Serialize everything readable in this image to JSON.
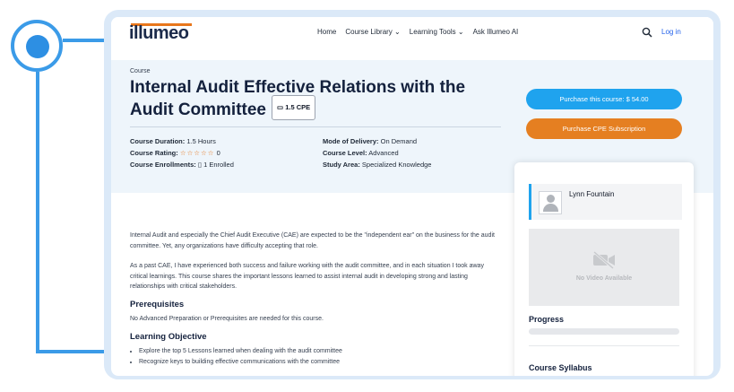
{
  "header": {
    "logo": "illumeo",
    "nav": [
      "Home",
      "Course Library",
      "Learning Tools",
      "Ask Illumeo AI"
    ],
    "login": "Log in"
  },
  "hero": {
    "breadcrumb": "Course",
    "title": "Internal Audit Effective Relations with the Audit Committee",
    "cpe_badge": "1.5 CPE",
    "meta_left": [
      {
        "label": "Course Duration:",
        "value": "1.5 Hours"
      },
      {
        "label": "Course Rating:",
        "value": "0"
      },
      {
        "label": "Course Enrollments:",
        "value": "1 Enrolled"
      }
    ],
    "meta_right": [
      {
        "label": "Mode of Delivery:",
        "value": "On Demand"
      },
      {
        "label": "Course Level:",
        "value": "Advanced"
      },
      {
        "label": "Study Area:",
        "value": "Specialized Knowledge"
      }
    ],
    "rating_stars": 0
  },
  "buttons": {
    "purchase": "Purchase this course: $ 54.00",
    "subscription": "Purchase CPE Subscription"
  },
  "card": {
    "instructor": "Lynn Fountain",
    "video_placeholder": "No Video Available",
    "progress_label": "Progress",
    "progress": 0,
    "syllabus_label": "Course Syllabus"
  },
  "content": {
    "p1": "Internal Audit and especially the Chief Audit Executive (CAE) are expected to be the \"independent ear\" on the business for the audit committee.  Yet, any organizations have difficulty accepting that role.",
    "p2": "As a past CAE, I have experienced both success and failure working with the audit committee, and in each situation I took away critical learnings.  This course shares the important lessons learned to assist internal audit in developing strong and lasting relationships with critical stakeholders.",
    "prereq_heading": "Prerequisites",
    "prereq_text": "No Advanced Preparation or Prerequisites are needed for this course.",
    "objective_heading": "Learning Objective",
    "objectives": [
      "Explore the top 5 Lessons learned when dealing with the audit committee",
      "Recognize keys to building effective communications with the committee"
    ]
  },
  "colors": {
    "accent_blue": "#1fa3ee",
    "accent_orange": "#e57f21",
    "deco_blue": "#3b9be8"
  }
}
